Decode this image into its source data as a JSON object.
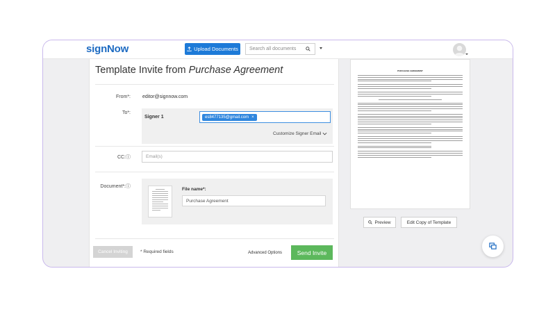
{
  "header": {
    "logo": "signNow",
    "upload_label": "Upload Documents",
    "search_placeholder": "Search all documents"
  },
  "form": {
    "title_prefix": "Template Invite from ",
    "title_doc": "Purchase Agreement",
    "from_label": "From*:",
    "from_value": "editor@signnow.com",
    "to_label": "To*:",
    "signer_label": "Signer 1",
    "signer_email": "es8477135@gmail.com",
    "chip_close": "×",
    "customize_label": "Customize Signer Email",
    "cc_label": "CC:",
    "cc_placeholder": "Email(s)",
    "document_label": "Document*:",
    "file_name_label": "File name*:",
    "file_name_value": "Purchase Agreement",
    "cancel_label": "Cancel Inviting",
    "required_note": "* Required fields",
    "advanced_label": "Advanced Options",
    "send_label": "Send Invite"
  },
  "preview": {
    "doc_heading": "PURCHASE AGREEMENT",
    "preview_label": "Preview",
    "edit_copy_label": "Edit Copy of Template"
  },
  "colors": {
    "brand": "#1d6bc2",
    "upload_button": "#1d7ad8",
    "send_button": "#5cb85c",
    "frame_border": "#c9b8ec"
  }
}
